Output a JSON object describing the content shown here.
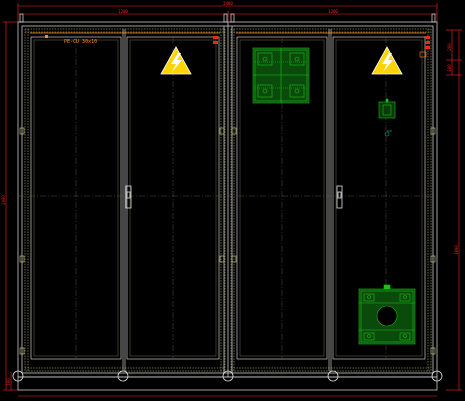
{
  "drawing": {
    "busbar_label": "PE-CU 30x10",
    "dims": {
      "overall_width": "2400",
      "cabinet_left_width": "1200",
      "cabinet_right_width": "1200",
      "overall_height": "2000",
      "right_height_upper": "1800",
      "right_small_a": "200",
      "right_small_b": "100",
      "bottom_offset": "100"
    },
    "colors": {
      "frame": "#c8c8c8",
      "hatch": "#d4d48a",
      "dimension": "#ff2020",
      "component_green": "#18c018",
      "warning_yellow": "#ffd400",
      "busbar_orange": "#ff8a1a",
      "background": "#000000"
    },
    "symbols": [
      "high-voltage-warning-sign",
      "high-voltage-warning-sign"
    ]
  }
}
